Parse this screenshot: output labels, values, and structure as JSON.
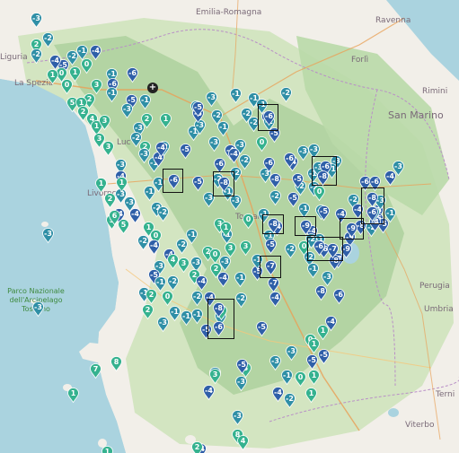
{
  "map": {
    "place_labels": [
      {
        "text": "Emilia-Romagna",
        "kind": "region"
      },
      {
        "text": "Ravenna",
        "kind": "city"
      },
      {
        "text": "Forlì",
        "kind": "city"
      },
      {
        "text": "Rimini",
        "kind": "city"
      },
      {
        "text": "San Marino",
        "kind": "country"
      },
      {
        "text": "Perugia",
        "kind": "city"
      },
      {
        "text": "Umbria",
        "kind": "region"
      },
      {
        "text": "Terni",
        "kind": "city"
      },
      {
        "text": "Viterbo",
        "kind": "city"
      },
      {
        "text": "La Spezia",
        "kind": "city"
      },
      {
        "text": "Livorno",
        "kind": "city"
      },
      {
        "text": "Luc",
        "kind": "city"
      },
      {
        "text": "Toscan",
        "kind": "region"
      },
      {
        "text": "Liguria",
        "kind": "region"
      },
      {
        "text": "Parco Nazionale dell'Arcipelago Toscano",
        "kind": "park"
      }
    ],
    "colors": {
      "sea": "#aad3df",
      "land": "#f2efe9",
      "forest": "#add19e",
      "marker_cold": "#2f5fa8",
      "marker_mid": "#2f8fa6",
      "marker_warm": "#35b28f"
    },
    "current_location_icon": "crosshair-icon",
    "highlighted_station_values": [
      "-6",
      "-6",
      "-8",
      "-6",
      "-8",
      "-8",
      "-9",
      "-9",
      "-6",
      "-7",
      "-7",
      "-8",
      "-6"
    ],
    "stations": [
      {
        "v": "-3"
      },
      {
        "v": "-2"
      },
      {
        "v": "2"
      },
      {
        "v": "-2"
      },
      {
        "v": "-1"
      },
      {
        "v": "-4"
      },
      {
        "v": "-2"
      },
      {
        "v": "-5"
      },
      {
        "v": "-4"
      },
      {
        "v": "0"
      },
      {
        "v": "1"
      },
      {
        "v": "0"
      },
      {
        "v": "1"
      },
      {
        "v": "0"
      },
      {
        "v": "3"
      },
      {
        "v": "2"
      },
      {
        "v": "5"
      },
      {
        "v": "1"
      },
      {
        "v": "2"
      },
      {
        "v": "4"
      },
      {
        "v": "1"
      },
      {
        "v": "3"
      },
      {
        "v": "3"
      },
      {
        "v": "-1"
      },
      {
        "v": "-6"
      },
      {
        "v": "-6"
      },
      {
        "v": "-1"
      },
      {
        "v": "-5"
      },
      {
        "v": "-1"
      },
      {
        "v": "-3"
      },
      {
        "v": "3"
      },
      {
        "v": "-3"
      },
      {
        "v": "2"
      },
      {
        "v": "1"
      },
      {
        "v": "-2"
      },
      {
        "v": "2"
      },
      {
        "v": "-2"
      },
      {
        "v": "-1"
      },
      {
        "v": "-3"
      },
      {
        "v": "-4"
      },
      {
        "v": "-3"
      },
      {
        "v": "-4"
      },
      {
        "v": "-3"
      },
      {
        "v": "-3"
      },
      {
        "v": "-1"
      },
      {
        "v": "-1"
      },
      {
        "v": "-2"
      },
      {
        "v": "-2"
      },
      {
        "v": "-4"
      },
      {
        "v": "-4"
      },
      {
        "v": "-5"
      },
      {
        "v": "-1"
      },
      {
        "v": "-2"
      },
      {
        "v": "-3"
      },
      {
        "v": "-3"
      },
      {
        "v": "-5"
      },
      {
        "v": "-2"
      },
      {
        "v": "-1"
      },
      {
        "v": "-1"
      },
      {
        "v": "-2"
      },
      {
        "v": "-2"
      },
      {
        "v": "-6"
      },
      {
        "v": "-5"
      },
      {
        "v": "-1"
      },
      {
        "v": "-3"
      },
      {
        "v": "-4"
      },
      {
        "v": "0"
      },
      {
        "v": "-2"
      },
      {
        "v": "-5"
      },
      {
        "v": "-2"
      },
      {
        "v": "-1"
      },
      {
        "v": "-3"
      },
      {
        "v": "-4"
      },
      {
        "v": "-2"
      },
      {
        "v": "-3"
      },
      {
        "v": "-2"
      },
      {
        "v": "-6"
      },
      {
        "v": "-6"
      },
      {
        "v": "-8"
      },
      {
        "v": "-4"
      },
      {
        "v": "-6"
      },
      {
        "v": "-5"
      },
      {
        "v": "-2"
      },
      {
        "v": "-1"
      },
      {
        "v": "-3"
      },
      {
        "v": "-3"
      },
      {
        "v": "-3"
      },
      {
        "v": "-1"
      },
      {
        "v": "-2"
      },
      {
        "v": "0"
      },
      {
        "v": "-1"
      },
      {
        "v": "-4"
      },
      {
        "v": "-2"
      },
      {
        "v": "-6"
      },
      {
        "v": "-5"
      },
      {
        "v": "-1"
      },
      {
        "v": "-6"
      },
      {
        "v": "-4"
      },
      {
        "v": "-3"
      },
      {
        "v": "-2"
      },
      {
        "v": "-6"
      },
      {
        "v": "-5"
      },
      {
        "v": "-3"
      },
      {
        "v": "-4"
      },
      {
        "v": "-3"
      },
      {
        "v": "-4"
      },
      {
        "v": "-8"
      },
      {
        "v": "-9"
      },
      {
        "v": "-1"
      },
      {
        "v": "-4"
      },
      {
        "v": "-5"
      },
      {
        "v": "-2"
      },
      {
        "v": "-6"
      },
      {
        "v": "-7"
      },
      {
        "v": "-8"
      },
      {
        "v": "-9"
      },
      {
        "v": "-4"
      },
      {
        "v": "-1"
      },
      {
        "v": "-1"
      },
      {
        "v": "-5"
      },
      {
        "v": "-2"
      },
      {
        "v": "-5"
      },
      {
        "v": "-7"
      },
      {
        "v": "-4"
      },
      {
        "v": "-5"
      },
      {
        "v": "0"
      },
      {
        "v": "-2"
      },
      {
        "v": "-1"
      },
      {
        "v": "-3"
      },
      {
        "v": "-8"
      },
      {
        "v": "-6"
      },
      {
        "v": "-4"
      },
      {
        "v": "1"
      },
      {
        "v": "0"
      },
      {
        "v": "-3"
      },
      {
        "v": "-5"
      },
      {
        "v": "1"
      },
      {
        "v": "-5"
      },
      {
        "v": "-3"
      },
      {
        "v": "-1"
      },
      {
        "v": "0"
      },
      {
        "v": "1"
      },
      {
        "v": "1"
      },
      {
        "v": "-4"
      },
      {
        "v": "-2"
      },
      {
        "v": "3"
      },
      {
        "v": "-3"
      },
      {
        "v": "-4"
      },
      {
        "v": "-3"
      },
      {
        "v": "-5"
      },
      {
        "v": "-3"
      },
      {
        "v": "-4"
      },
      {
        "v": "-3"
      },
      {
        "v": "-3"
      },
      {
        "v": "7"
      },
      {
        "v": "8"
      },
      {
        "v": "1"
      },
      {
        "v": "1"
      },
      {
        "v": "2"
      },
      {
        "v": "8"
      },
      {
        "v": "4"
      },
      {
        "v": "3"
      },
      {
        "v": "5"
      },
      {
        "v": "-4"
      },
      {
        "v": "-1"
      },
      {
        "v": "2"
      },
      {
        "v": "0"
      },
      {
        "v": "-1"
      },
      {
        "v": "2"
      },
      {
        "v": "-3"
      },
      {
        "v": "-1"
      },
      {
        "v": "-5"
      },
      {
        "v": "-1"
      },
      {
        "v": "-3"
      },
      {
        "v": "-4"
      },
      {
        "v": "0"
      },
      {
        "v": "-2"
      },
      {
        "v": "-1"
      },
      {
        "v": "-4"
      },
      {
        "v": "-3"
      },
      {
        "v": "2"
      },
      {
        "v": "-1"
      },
      {
        "v": "6"
      },
      {
        "v": "5"
      },
      {
        "v": "1"
      },
      {
        "v": "0"
      },
      {
        "v": "-2"
      },
      {
        "v": "-4"
      },
      {
        "v": "-4"
      },
      {
        "v": "4"
      },
      {
        "v": "-3"
      },
      {
        "v": "-5"
      },
      {
        "v": "-1"
      },
      {
        "v": "3"
      },
      {
        "v": "-2"
      },
      {
        "v": "-2"
      },
      {
        "v": "0"
      },
      {
        "v": "-3"
      },
      {
        "v": "2"
      },
      {
        "v": "-4"
      },
      {
        "v": "2"
      },
      {
        "v": "3"
      },
      {
        "v": "3"
      },
      {
        "v": "-1"
      },
      {
        "v": "-2"
      },
      {
        "v": "-1"
      },
      {
        "v": "-3"
      },
      {
        "v": "-2"
      },
      {
        "v": "-5"
      },
      {
        "v": "-1"
      },
      {
        "v": "-3"
      },
      {
        "v": "3"
      },
      {
        "v": "1"
      },
      {
        "v": "0"
      },
      {
        "v": "-1"
      },
      {
        "v": "-2"
      },
      {
        "v": "-5"
      },
      {
        "v": "-3"
      },
      {
        "v": "1"
      },
      {
        "v": "2"
      },
      {
        "v": "1"
      }
    ]
  }
}
